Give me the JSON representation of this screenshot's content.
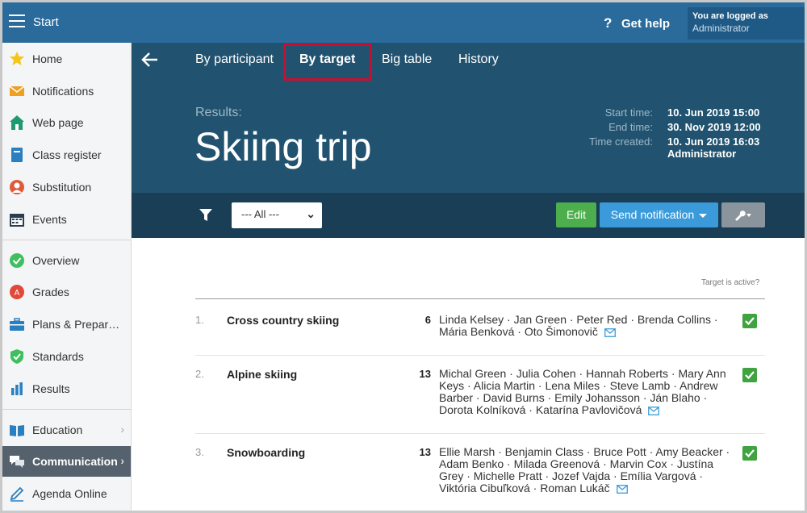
{
  "topbar": {
    "start_label": "Start",
    "help_label": "Get help",
    "login_line1": "You are logged as",
    "login_line2": "Administrator"
  },
  "sidebar": {
    "items": [
      {
        "label": "Home",
        "icon": "star-icon"
      },
      {
        "label": "Notifications",
        "icon": "envelope-icon"
      },
      {
        "label": "Web page",
        "icon": "house-icon"
      },
      {
        "label": "Class register",
        "icon": "book-icon"
      },
      {
        "label": "Substitution",
        "icon": "person-icon"
      },
      {
        "label": "Events",
        "icon": "calendar-icon"
      },
      {
        "label": "Overview",
        "icon": "check-circle-icon"
      },
      {
        "label": "Grades",
        "icon": "grades-icon"
      },
      {
        "label": "Plans & Prepar…",
        "icon": "briefcase-icon"
      },
      {
        "label": "Standards",
        "icon": "shield-check-icon"
      },
      {
        "label": "Results",
        "icon": "bar-chart-icon"
      },
      {
        "label": "Education",
        "icon": "open-book-icon"
      },
      {
        "label": "Communication",
        "icon": "chat-icon"
      },
      {
        "label": "Agenda Online",
        "icon": "pen-icon"
      }
    ]
  },
  "header": {
    "tabs": [
      "By participant",
      "By target",
      "Big table",
      "History"
    ],
    "results_label": "Results:",
    "title": "Skiing trip",
    "meta_keys": [
      "Start time:",
      "End time:",
      "Time created:"
    ],
    "meta_values": [
      "10. Jun 2019 15:00",
      "30. Nov 2019 12:00",
      "10. Jun 2019 16:03",
      "Administrator"
    ]
  },
  "toolbar": {
    "filter_value": "--- All ---",
    "edit_label": "Edit",
    "send_label": "Send notification"
  },
  "content": {
    "active_header": "Target is active?",
    "rows": [
      {
        "num": "1.",
        "name": "Cross country skiing",
        "count": "6",
        "people": "Linda Kelsey · Jan Green · Peter Red · Brenda Collins · Mária Benková · Oto Šimonovič"
      },
      {
        "num": "2.",
        "name": "Alpine skiing",
        "count": "13",
        "people": "Michal Green · Julia Cohen · Hannah Roberts · Mary Ann Keys · Alicia Martin · Lena Miles · Steve Lamb · Andrew Barber · David Burns · Emily Johansson · Ján Blaho · Dorota Kolníková · Katarína Pavlovičová"
      },
      {
        "num": "3.",
        "name": "Snowboarding",
        "count": "13",
        "people": "Ellie Marsh · Benjamin Class · Bruce Pott · Amy Beacker · Adam Benko · Milada Greenová · Marvin Cox · Justína Grey · Michelle Pratt · Jozef Vajda · Emília Vargová · Viktória Cibuľková · Roman Lukáč"
      }
    ]
  }
}
